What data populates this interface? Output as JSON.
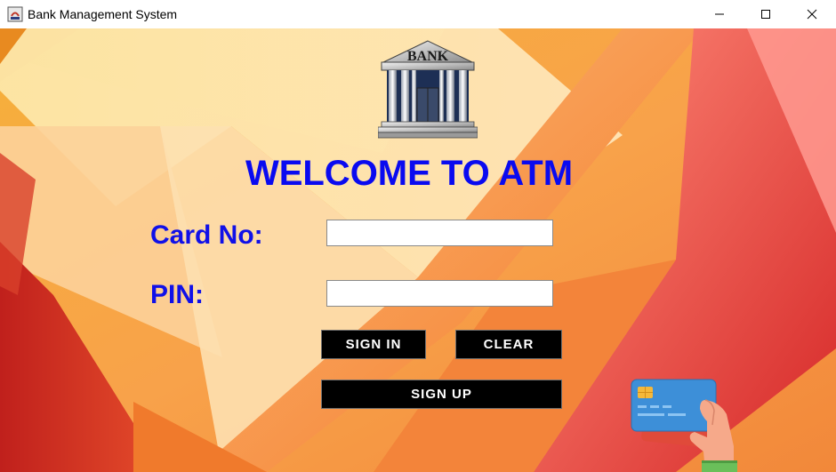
{
  "window": {
    "title": "Bank Management System",
    "icon": "java-app-icon",
    "controls": [
      "minimize-icon",
      "maximize-icon",
      "close-icon"
    ]
  },
  "logo": {
    "text": "BANK",
    "icon": "bank-building-icon"
  },
  "heading": "WELCOME TO ATM",
  "form": {
    "card_label": "Card No:",
    "card_value": "",
    "pin_label": "PIN:",
    "pin_value": ""
  },
  "buttons": {
    "sign_in": "SIGN IN",
    "clear": "CLEAR",
    "sign_up": "SIGN UP"
  },
  "illustration": {
    "icon": "hand-credit-card-icon"
  },
  "colors": {
    "heading": "#0a0af0",
    "labels": "#1010e8",
    "button_bg": "#000000",
    "button_text": "#ffffff"
  }
}
